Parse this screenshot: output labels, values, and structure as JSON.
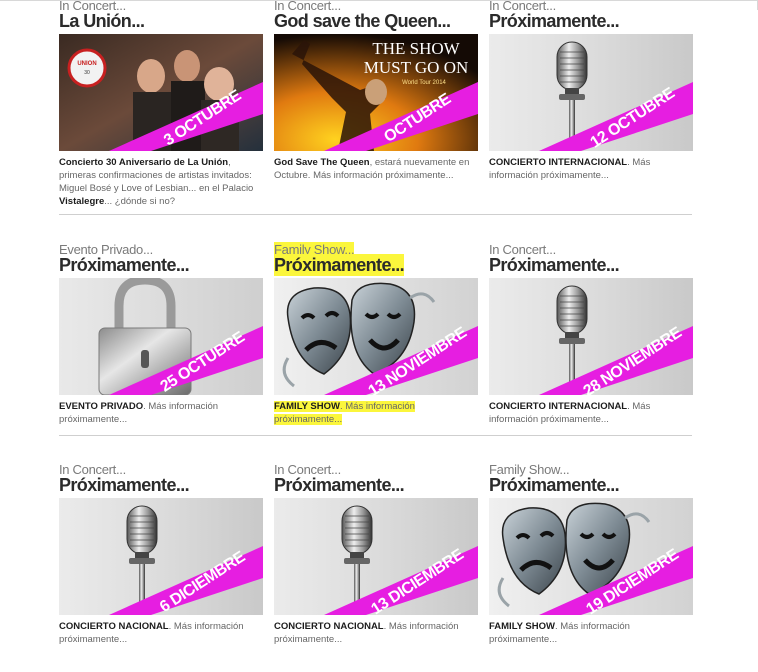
{
  "events": [
    {
      "category": "In Concert...",
      "title": "La Unión...",
      "date": "3 OCTUBRE",
      "image": "band-photo",
      "desc_parts": [
        {
          "t": "Concierto 30 Aniversario de La Unión",
          "b": true
        },
        {
          "t": ", primeras confirmaciones de artistas invitados: Miguel Bosé y Love of Lesbian... en el Palacio ",
          "b": false
        },
        {
          "t": "Vistalegre",
          "b": true
        },
        {
          "t": "... ¿dónde si no?",
          "b": false
        }
      ]
    },
    {
      "category": "In Concert...",
      "title": "God save the Queen...",
      "date": "OCTUBRE",
      "image": "show-poster",
      "poster": {
        "line1": "THE SHOW",
        "line2": "MUST GO ON",
        "line3": "World Tour 2014"
      },
      "desc_parts": [
        {
          "t": "God Save The Queen",
          "b": true
        },
        {
          "t": ", estará nuevamente en Octubre. Más información próximamente...",
          "b": false
        }
      ]
    },
    {
      "category": "In Concert...",
      "title": "Próximamente...",
      "date": "12 OCTUBRE",
      "image": "microphone-icon",
      "desc_parts": [
        {
          "t": "CONCIERTO INTERNACIONAL",
          "b": true
        },
        {
          "t": ". Más información próximamente...",
          "b": false
        }
      ]
    },
    {
      "category": "Evento Privado...",
      "title": "Próximamente...",
      "date": "25 OCTUBRE",
      "image": "padlock-icon",
      "desc_parts": [
        {
          "t": "EVENTO PRIVADO",
          "b": true
        },
        {
          "t": ". Más información próximamente...",
          "b": false
        }
      ]
    },
    {
      "category": "Family Show...",
      "title": "Próximamente...",
      "date": "13 NOVIEMBRE",
      "image": "theater-masks-icon",
      "highlight": true,
      "desc_parts": [
        {
          "t": "FAMILY SHOW",
          "b": true
        },
        {
          "t": ". Más información próximamente...",
          "b": false
        }
      ]
    },
    {
      "category": "In Concert...",
      "title": "Próximamente...",
      "date": "28 NOVIEMBRE",
      "image": "microphone-icon",
      "desc_parts": [
        {
          "t": "CONCIERTO INTERNACIONAL",
          "b": true
        },
        {
          "t": ". Más información próximamente...",
          "b": false
        }
      ]
    },
    {
      "category": "In Concert...",
      "title": "Próximamente...",
      "date": "6 DICIEMBRE",
      "image": "microphone-icon",
      "desc_parts": [
        {
          "t": "CONCIERTO NACIONAL",
          "b": true
        },
        {
          "t": ". Más información próximamente...",
          "b": false
        }
      ]
    },
    {
      "category": "In Concert...",
      "title": "Próximamente...",
      "date": "13 DICIEMBRE",
      "image": "microphone-icon",
      "desc_parts": [
        {
          "t": "CONCIERTO NACIONAL",
          "b": true
        },
        {
          "t": ". Más información próximamente...",
          "b": false
        }
      ]
    },
    {
      "category": "Family Show...",
      "title": "Próximamente...",
      "date": "19 DICIEMBRE",
      "image": "theater-masks-icon",
      "desc_parts": [
        {
          "t": "FAMILY SHOW",
          "b": true
        },
        {
          "t": ". Más información próximamente...",
          "b": false
        }
      ]
    }
  ],
  "colors": {
    "banner": "#e61ee1",
    "highlight": "#fbf63c",
    "separator": "#cfcfcf"
  }
}
